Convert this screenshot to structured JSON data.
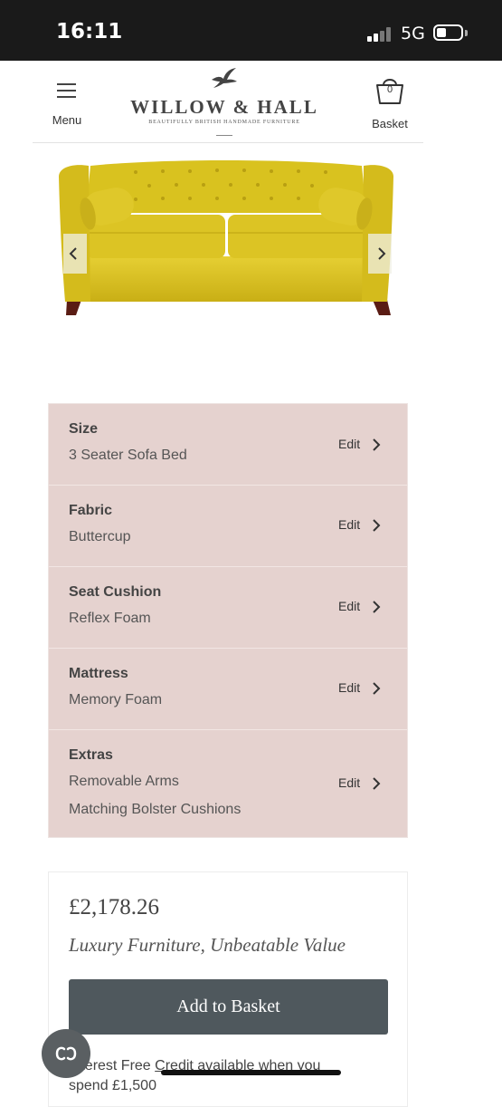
{
  "status": {
    "time": "16:11",
    "network": "5G"
  },
  "header": {
    "menu_label": "Menu",
    "brand_name": "WILLOW & HALL",
    "brand_tagline": "BEAUTIFULLY BRITISH HANDMADE FURNITURE",
    "basket_label": "Basket",
    "basket_count": "0"
  },
  "product": {
    "image_icon": "yellow-sofa-image",
    "fabric_color": "#d9c21f"
  },
  "options": [
    {
      "title": "Size",
      "values": [
        "3 Seater Sofa Bed"
      ],
      "edit": "Edit"
    },
    {
      "title": "Fabric",
      "values": [
        "Buttercup"
      ],
      "edit": "Edit"
    },
    {
      "title": "Seat Cushion",
      "values": [
        "Reflex Foam"
      ],
      "edit": "Edit"
    },
    {
      "title": "Mattress",
      "values": [
        "Memory Foam"
      ],
      "edit": "Edit"
    },
    {
      "title": "Extras",
      "values": [
        "Removable Arms",
        "Matching Bolster Cushions"
      ],
      "edit": "Edit"
    }
  ],
  "purchase": {
    "price": "£2,178.26",
    "tagline": "Luxury Furniture, Unbeatable Value",
    "add_to_basket": "Add to Basket",
    "credit_prefix": "Interest Free ",
    "credit_link": "Credit available when you",
    "credit_suffix": "spend £1,500"
  },
  "colors": {
    "options_bg": "#e5d2cf",
    "button_bg": "#4f585d",
    "status_bg": "#1a1a1a"
  }
}
